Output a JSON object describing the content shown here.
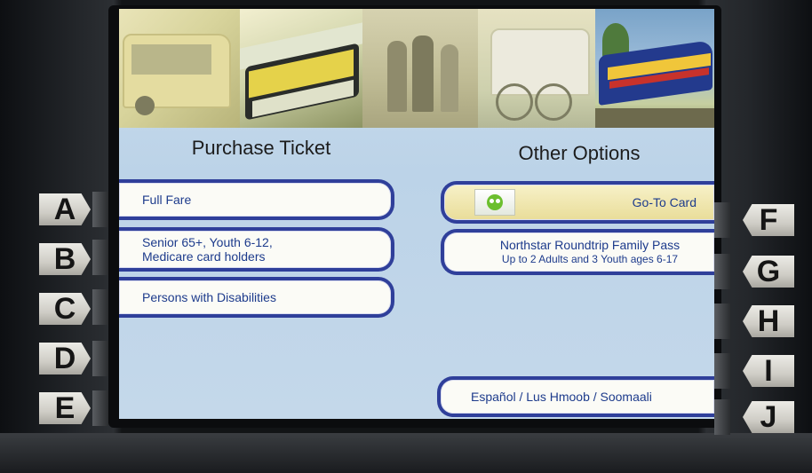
{
  "left_panel": {
    "title": "Purchase Ticket",
    "buttons": [
      {
        "line1": "Full Fare",
        "line2": ""
      },
      {
        "line1": "Senior 65+, Youth 6-12,",
        "line2": "Medicare card holders"
      },
      {
        "line1": "Persons with Disabilities",
        "line2": ""
      }
    ]
  },
  "right_panel": {
    "title": "Other Options",
    "buttons": [
      {
        "line1": "Go-To Card",
        "line2": "",
        "icon": "go-to-card-icon"
      },
      {
        "line1": "Northstar Roundtrip Family Pass",
        "line2": "Up to 2 Adults and 3 Youth ages 6-17"
      },
      {
        "line1": "Español / Lus Hmoob / Soomaali",
        "line2": ""
      }
    ]
  },
  "side_keys": {
    "left": [
      "A",
      "B",
      "C",
      "D",
      "E"
    ],
    "right": [
      "F",
      "G",
      "H",
      "I",
      "J"
    ]
  },
  "colors": {
    "button_border": "#2f3f9a",
    "button_text": "#1d3b8c",
    "screen_background": "#c4d8ea"
  }
}
